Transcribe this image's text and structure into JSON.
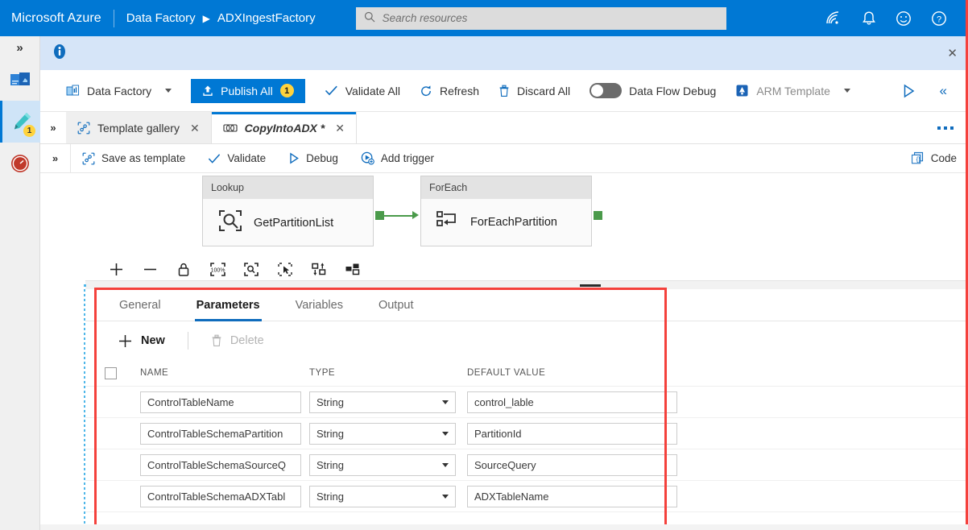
{
  "topbar": {
    "brand": "Microsoft Azure",
    "service": "Data Factory",
    "resource": "ADXIngestFactory",
    "separator_arrow": "▶",
    "search_placeholder": "Search resources",
    "search_value": "",
    "icons": [
      "cloud-shell-icon",
      "notifications-bell-icon",
      "feedback-smiley-icon",
      "help-question-icon"
    ]
  },
  "rail": {
    "expand_label": "»",
    "items": [
      {
        "name": "home-overview",
        "badge": ""
      },
      {
        "name": "author-pencil",
        "badge": "1"
      },
      {
        "name": "monitor-gauge",
        "badge": ""
      }
    ]
  },
  "infobar": {
    "message": "",
    "close_label": "✕"
  },
  "toolbar": {
    "factory_label": "Data Factory",
    "publish_label": "Publish All",
    "publish_count": "1",
    "validate_all_label": "Validate All",
    "refresh_label": "Refresh",
    "discard_all_label": "Discard All",
    "data_flow_debug_label": "Data Flow Debug",
    "data_flow_debug_state": "off",
    "arm_template_label": "ARM Template",
    "run_label": "",
    "collapse_label": "«"
  },
  "tabs": {
    "expand_label": "»",
    "items": [
      {
        "label": "Template gallery",
        "icon": "template-gallery-icon",
        "active": false,
        "close": "✕"
      },
      {
        "label": "CopyIntoADX *",
        "icon": "pipeline-icon",
        "active": true,
        "close": "✕"
      }
    ],
    "overflow_label": "..."
  },
  "pipeline_toolbar": {
    "expand_label": "»",
    "save_as_template_label": "Save as template",
    "validate_label": "Validate",
    "debug_label": "Debug",
    "add_trigger_label": "Add trigger",
    "code_label": "Code"
  },
  "canvas": {
    "activities": [
      {
        "type": "Lookup",
        "name": "GetPartitionList",
        "icon": "lookup-magnifier-icon"
      },
      {
        "type": "ForEach",
        "name": "ForEachPartition",
        "icon": "foreach-loop-icon"
      }
    ],
    "tools": [
      "zoom-in-icon",
      "zoom-out-icon",
      "lock-icon",
      "zoom-100-icon",
      "zoom-to-fit-icon",
      "select-all-icon",
      "auto-align-icon",
      "layout-icon"
    ],
    "connector_color": "#4a9a4a"
  },
  "properties": {
    "tabs": [
      {
        "label": "General",
        "active": false
      },
      {
        "label": "Parameters",
        "active": true
      },
      {
        "label": "Variables",
        "active": false
      },
      {
        "label": "Output",
        "active": false
      }
    ],
    "new_label": "New",
    "delete_label": "Delete",
    "delete_enabled": false,
    "columns": [
      "NAME",
      "TYPE",
      "DEFAULT VALUE"
    ],
    "rows": [
      {
        "name": "ControlTableName",
        "type": "String",
        "default": "control_lable"
      },
      {
        "name": "ControlTableSchemaPartition",
        "type": "String",
        "default": "PartitionId"
      },
      {
        "name": "ControlTableSchemaSourceQ",
        "type": "String",
        "default": "SourceQuery"
      },
      {
        "name": "ControlTableSchemaADXTabl",
        "type": "String",
        "default": "ADXTableName"
      }
    ]
  },
  "highlight": {
    "color": "#f4413c"
  }
}
